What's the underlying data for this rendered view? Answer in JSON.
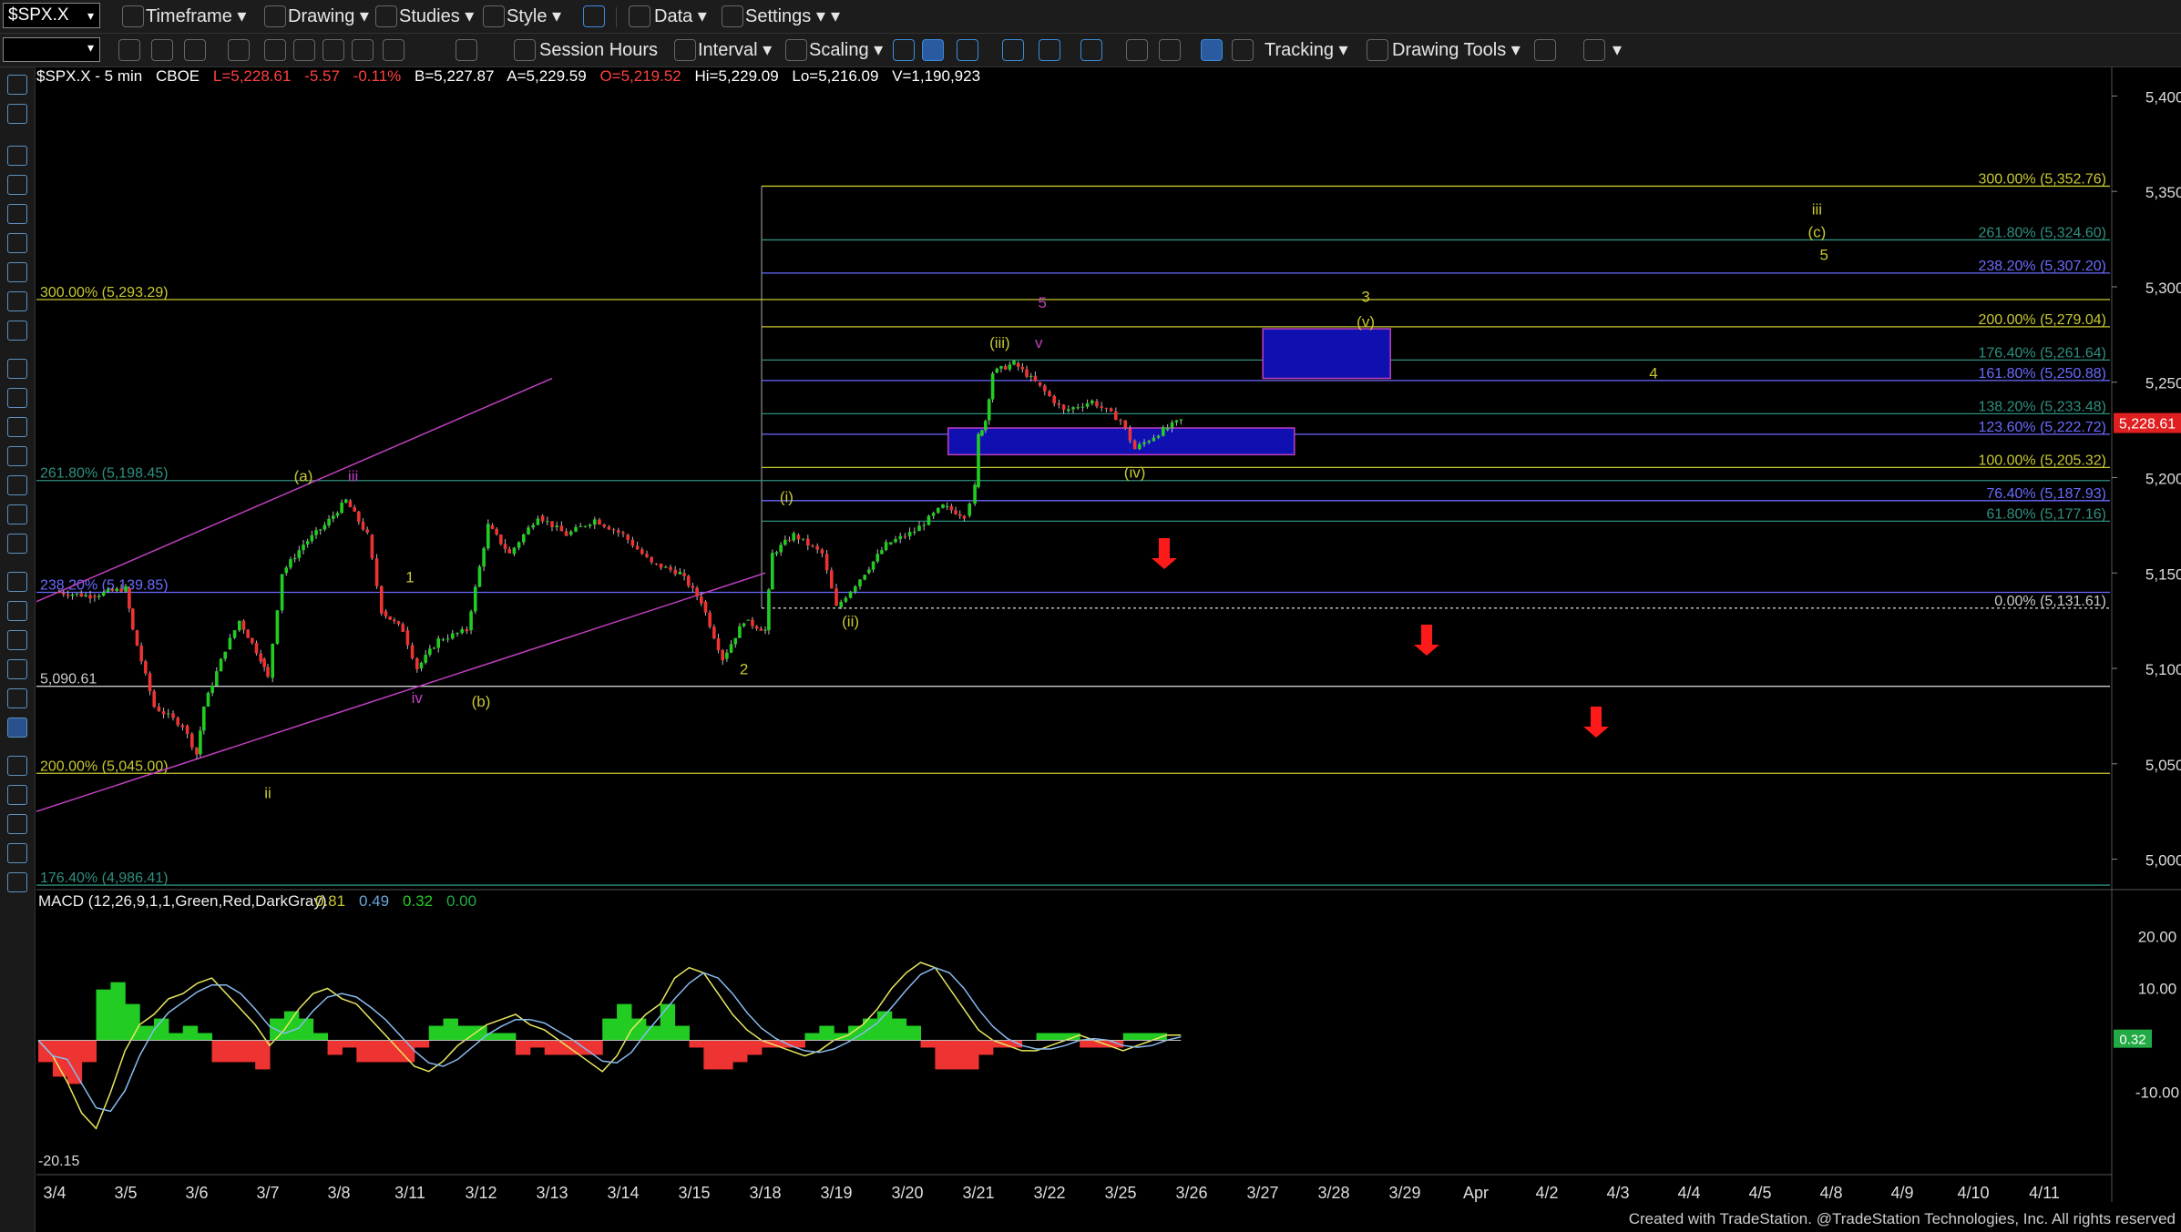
{
  "toolbar1": {
    "symbol": "$SPX.X",
    "timeframe": "Timeframe",
    "drawing": "Drawing",
    "studies": "Studies",
    "style": "Style",
    "data": "Data",
    "settings": "Settings"
  },
  "toolbar2": {
    "session_hours": "Session Hours",
    "interval": "Interval",
    "scaling": "Scaling",
    "tracking": "Tracking",
    "drawing_tools": "Drawing Tools"
  },
  "info": {
    "symbol": "$SPX.X - 5 min",
    "exchange": "CBOE",
    "last": "L=5,228.61",
    "change": "-5.57",
    "change_pct": "-0.11%",
    "bid": "B=5,227.87",
    "ask": "A=5,229.59",
    "open": "O=5,219.52",
    "high": "Hi=5,229.09",
    "low": "Lo=5,216.09",
    "volume": "V=1,190,923"
  },
  "colors": {
    "up": "#22cc22",
    "down": "#ee3333",
    "yellow": "#c8c832",
    "blue": "#6a6aff",
    "teal": "#2f8f7f",
    "magenta": "#c040c0",
    "price_tag": "#e02020",
    "macd_tag": "#22aa44"
  },
  "chart_data": {
    "type": "candlestick",
    "price_axis": {
      "ticks": [
        "5,400.00",
        "5,350.00",
        "5,300.00",
        "5,250.00",
        "5,200.00",
        "5,150.00",
        "5,100.00",
        "5,050.00",
        "5,000.00"
      ],
      "range": [
        4985,
        5415
      ],
      "last_tag": "5,228.61"
    },
    "date_axis": {
      "ticks": [
        "3/4",
        "3/5",
        "3/6",
        "3/7",
        "3/8",
        "3/11",
        "3/12",
        "3/13",
        "3/14",
        "3/15",
        "3/18",
        "3/19",
        "3/20",
        "3/21",
        "3/22",
        "3/25",
        "3/26",
        "3/27",
        "3/28",
        "3/29",
        "Apr",
        "4/2",
        "4/3",
        "4/4",
        "4/5",
        "4/8",
        "4/9",
        "4/10",
        "4/11"
      ]
    },
    "price_path": [
      [
        0,
        5140
      ],
      [
        0.5,
        5138
      ],
      [
        1,
        5142
      ],
      [
        1.1,
        5120
      ],
      [
        1.4,
        5080
      ],
      [
        1.8,
        5070
      ],
      [
        2,
        5055
      ],
      [
        2.1,
        5080
      ],
      [
        2.4,
        5110
      ],
      [
        2.6,
        5125
      ],
      [
        2.9,
        5105
      ],
      [
        3,
        5095
      ],
      [
        3.2,
        5150
      ],
      [
        3.5,
        5165
      ],
      [
        3.8,
        5175
      ],
      [
        4.1,
        5188
      ],
      [
        4.4,
        5170
      ],
      [
        4.6,
        5130
      ],
      [
        4.9,
        5120
      ],
      [
        5.1,
        5100
      ],
      [
        5.4,
        5115
      ],
      [
        5.8,
        5120
      ],
      [
        6.1,
        5175
      ],
      [
        6.4,
        5160
      ],
      [
        6.8,
        5180
      ],
      [
        7.2,
        5170
      ],
      [
        7.6,
        5178
      ],
      [
        8,
        5170
      ],
      [
        8.4,
        5155
      ],
      [
        8.8,
        5150
      ],
      [
        9.1,
        5135
      ],
      [
        9.4,
        5105
      ],
      [
        9.7,
        5125
      ],
      [
        10,
        5120
      ],
      [
        10.1,
        5160
      ],
      [
        10.4,
        5170
      ],
      [
        10.8,
        5160
      ],
      [
        11,
        5132
      ],
      [
        11.4,
        5150
      ],
      [
        11.7,
        5165
      ],
      [
        12.1,
        5172
      ],
      [
        12.5,
        5185
      ],
      [
        12.8,
        5180
      ],
      [
        12.95,
        5195
      ],
      [
        13,
        5222
      ],
      [
        13.1,
        5230
      ],
      [
        13.2,
        5255
      ],
      [
        13.5,
        5260
      ],
      [
        13.8,
        5250
      ],
      [
        14.2,
        5235
      ],
      [
        14.6,
        5240
      ],
      [
        15,
        5230
      ],
      [
        15.2,
        5215
      ],
      [
        15.6,
        5225
      ],
      [
        15.85,
        5230
      ]
    ],
    "fib_levels": [
      {
        "label": "300.00% (5,352.76)",
        "price": 5352.76,
        "color": "yellow"
      },
      {
        "label": "261.80% (5,324.60)",
        "price": 5324.6,
        "color": "teal"
      },
      {
        "label": "238.20% (5,307.20)",
        "price": 5307.2,
        "color": "blue"
      },
      {
        "label": "200.00% (5,279.04)",
        "price": 5279.04,
        "color": "yellow"
      },
      {
        "label": "176.40% (5,261.64)",
        "price": 5261.64,
        "color": "teal"
      },
      {
        "label": "161.80% (5,250.88)",
        "price": 5250.88,
        "color": "blue"
      },
      {
        "label": "138.20% (5,233.48)",
        "price": 5233.48,
        "color": "teal"
      },
      {
        "label": "123.60% (5,222.72)",
        "price": 5222.72,
        "color": "blue"
      },
      {
        "label": "100.00% (5,205.32)",
        "price": 5205.32,
        "color": "yellow"
      },
      {
        "label": "76.40% (5,187.93)",
        "price": 5187.93,
        "color": "blue"
      },
      {
        "label": "61.80% (5,177.16)",
        "price": 5177.16,
        "color": "teal"
      },
      {
        "label": "0.00% (5,131.61)",
        "price": 5131.61,
        "color": "white"
      }
    ],
    "left_levels": [
      {
        "label": "300.00% (5,293.29)",
        "price": 5293.29,
        "color": "yellow"
      },
      {
        "label": "261.80% (5,198.45)",
        "price": 5198.45,
        "color": "teal"
      },
      {
        "label": "238.20% (5,139.85)",
        "price": 5139.85,
        "color": "blue"
      },
      {
        "label": "5,090.61",
        "price": 5090.61,
        "color": "white"
      },
      {
        "label": "200.00% (5,045.00)",
        "price": 5045.0,
        "color": "yellow"
      },
      {
        "label": "176.40% (4,986.41)",
        "price": 4986.41,
        "color": "teal"
      }
    ],
    "wave_labels": [
      {
        "t": "(a)",
        "x": 3.5,
        "p": 5198,
        "c": "yellow"
      },
      {
        "t": "iii",
        "x": 4.2,
        "p": 5198,
        "c": "magenta"
      },
      {
        "t": "1",
        "x": 5.0,
        "p": 5145,
        "c": "yellow"
      },
      {
        "t": "iv",
        "x": 5.1,
        "p": 5082,
        "c": "magenta"
      },
      {
        "t": "(b)",
        "x": 6.0,
        "p": 5080,
        "c": "yellow"
      },
      {
        "t": "ii",
        "x": 3.0,
        "p": 5032,
        "c": "yellow"
      },
      {
        "t": "2",
        "x": 9.7,
        "p": 5097,
        "c": "yellow"
      },
      {
        "t": "(i)",
        "x": 10.3,
        "p": 5187,
        "c": "yellow"
      },
      {
        "t": "(ii)",
        "x": 11.2,
        "p": 5122,
        "c": "yellow"
      },
      {
        "t": "(iii)",
        "x": 13.3,
        "p": 5268,
        "c": "yellow"
      },
      {
        "t": "5",
        "x": 13.9,
        "p": 5289,
        "c": "magenta"
      },
      {
        "t": "v",
        "x": 13.85,
        "p": 5268,
        "c": "magenta"
      },
      {
        "t": "(iv)",
        "x": 15.2,
        "p": 5200,
        "c": "yellow"
      },
      {
        "t": "3",
        "x": 18.45,
        "p": 5292,
        "c": "yellow"
      },
      {
        "t": "(v)",
        "x": 18.45,
        "p": 5279,
        "c": "yellow"
      },
      {
        "t": "4",
        "x": 22.5,
        "p": 5252,
        "c": "yellow"
      },
      {
        "t": "iii",
        "x": 24.8,
        "p": 5338,
        "c": "yellow"
      },
      {
        "t": "(c)",
        "x": 24.8,
        "p": 5326,
        "c": "yellow"
      },
      {
        "t": "5",
        "x": 24.9,
        "p": 5314,
        "c": "yellow"
      }
    ],
    "macd": {
      "label": "MACD (12,26,9,1,1,Green,Red,DarkGray)",
      "values": [
        "0.81",
        "0.49",
        "0.32",
        "0.00"
      ],
      "ticks": [
        "20.00",
        "10.00",
        "-10.00"
      ],
      "last_tag": "0.32",
      "min_label": "-20.15",
      "series": [
        0,
        -3,
        -8,
        -14,
        -17,
        -10,
        -2,
        3,
        5,
        8,
        9,
        11,
        12,
        9,
        6,
        3,
        -1,
        2,
        6,
        9,
        10,
        8,
        7,
        4,
        1,
        -2,
        -5,
        -6,
        -4,
        -1,
        1,
        3,
        4,
        5,
        3,
        2,
        0,
        -2,
        -4,
        -6,
        -3,
        2,
        5,
        7,
        12,
        14,
        13,
        9,
        5,
        2,
        0,
        -1,
        -2,
        -3,
        -2,
        0,
        1,
        3,
        6,
        10,
        13,
        15,
        14,
        10,
        6,
        2,
        0,
        -1,
        -2,
        -2,
        -1,
        0,
        1,
        0,
        -1,
        -2,
        -1,
        0,
        1,
        1
      ]
    }
  },
  "footer": "Created with TradeStation. @TradeStation Technologies, Inc. All rights reserved"
}
